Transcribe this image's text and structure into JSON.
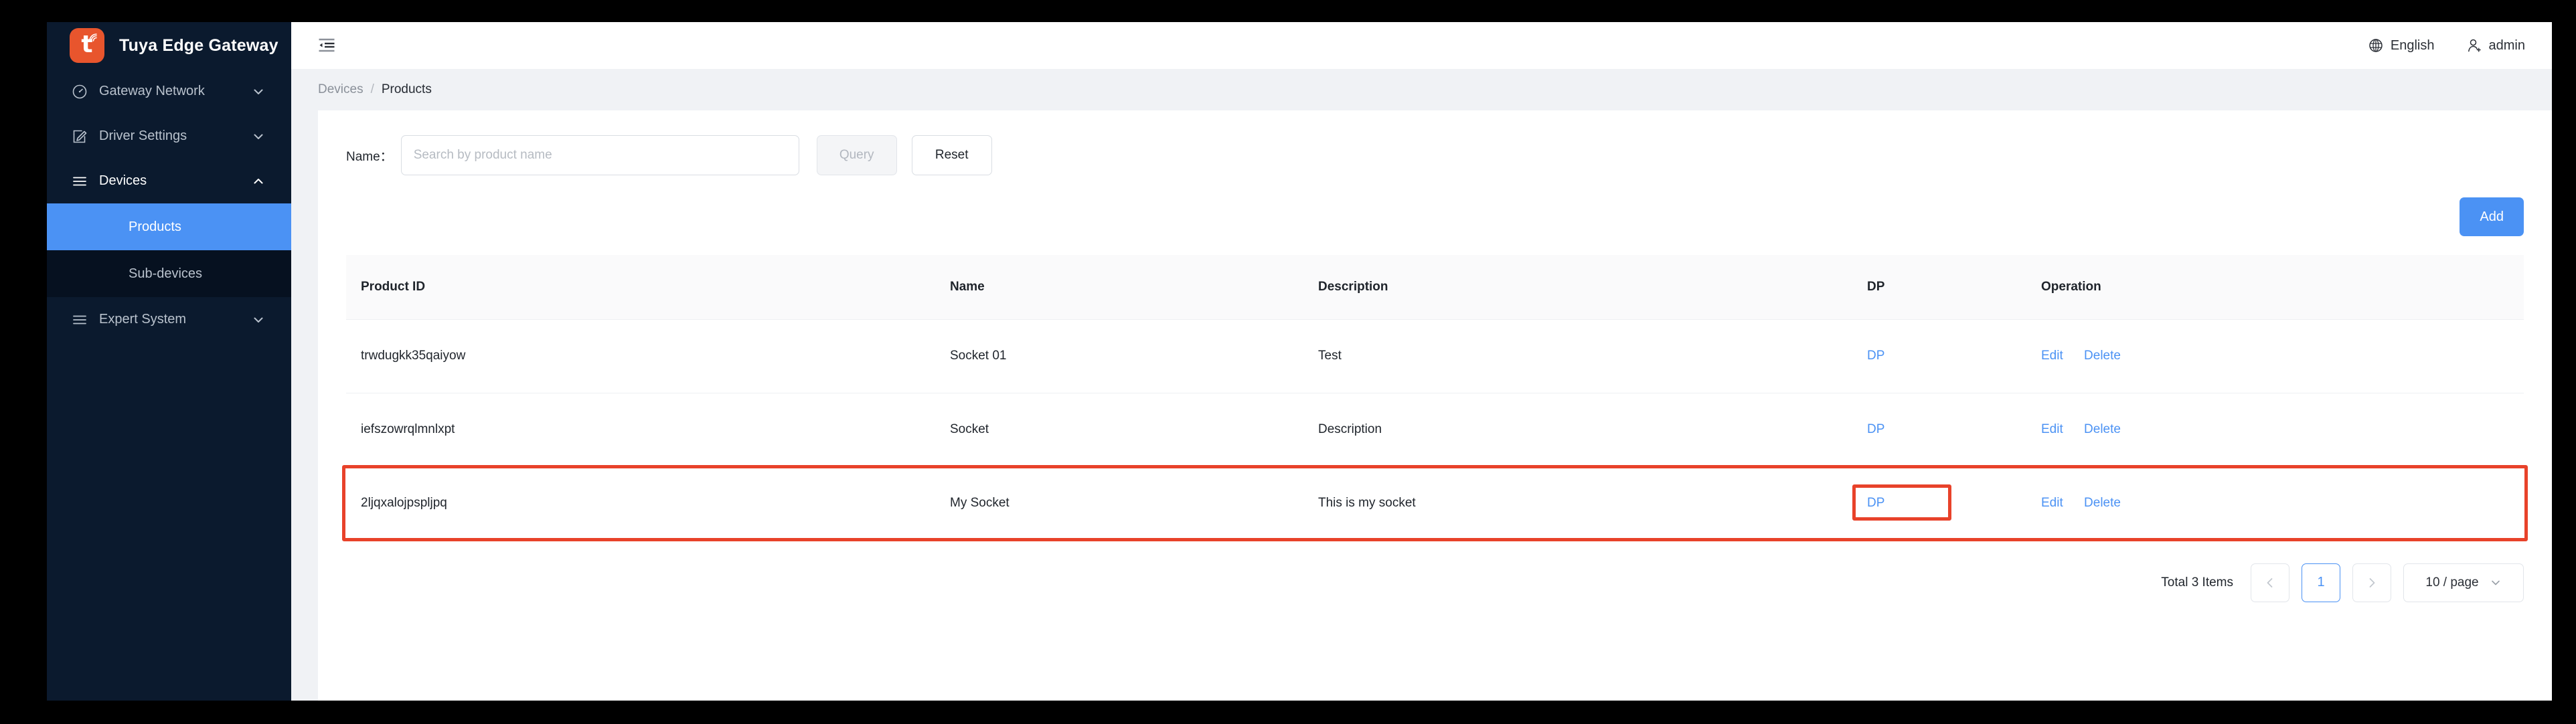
{
  "brand": {
    "title": "Tuya Edge Gateway",
    "logo_color": "#e8552d",
    "logo_glyph": "t"
  },
  "sidebar": {
    "background": "#0b1a2e",
    "active_color": "#4b92f4",
    "items": [
      {
        "label": "Gateway Network",
        "icon": "gauge-icon",
        "caret": "chevron-down-icon",
        "expanded": false
      },
      {
        "label": "Driver Settings",
        "icon": "edit-square-icon",
        "caret": "chevron-down-icon",
        "expanded": false
      },
      {
        "label": "Devices",
        "icon": "menu-lines-icon",
        "caret": "chevron-up-icon",
        "expanded": true
      },
      {
        "label": "Expert System",
        "icon": "menu-lines-icon",
        "caret": "chevron-down-icon",
        "expanded": false
      }
    ],
    "devices_children": [
      {
        "label": "Products",
        "active": true
      },
      {
        "label": "Sub-devices",
        "active": false
      }
    ]
  },
  "topbar": {
    "collapse_icon": "menu-fold-icon",
    "language": {
      "label": "English",
      "icon": "globe-icon"
    },
    "user": {
      "label": "admin",
      "icon": "user-add-icon"
    }
  },
  "breadcrumb": {
    "parent": "Devices",
    "separator": "/",
    "current": "Products"
  },
  "filter": {
    "name_label": "Name：",
    "search_placeholder": "Search by product name",
    "search_value": "",
    "query_label": "Query",
    "reset_label": "Reset"
  },
  "toolbar": {
    "add_label": "Add"
  },
  "table": {
    "columns": [
      "Product ID",
      "Name",
      "Description",
      "DP",
      "Operation"
    ],
    "rows": [
      {
        "product_id": "trwdugkk35qaiyow",
        "name": "Socket 01",
        "description": "Test",
        "dp": "DP",
        "edit": "Edit",
        "delete": "Delete",
        "highlighted": false
      },
      {
        "product_id": "iefszowrqlmnlxpt",
        "name": "Socket",
        "description": "Description",
        "dp": "DP",
        "edit": "Edit",
        "delete": "Delete",
        "highlighted": false
      },
      {
        "product_id": "2ljqxalojpspljpq",
        "name": "My Socket",
        "description": "This is my socket",
        "dp": "DP",
        "edit": "Edit",
        "delete": "Delete",
        "highlighted": true
      }
    ]
  },
  "pagination": {
    "total_text": "Total 3 Items",
    "prev_icon": "chevron-left-icon",
    "next_icon": "chevron-right-icon",
    "current_page": "1",
    "page_size": "10 / page",
    "page_size_caret": "chevron-down-icon"
  },
  "annotation": {
    "highlight_color": "#e8422a",
    "targets": [
      "product-row-3",
      "dp-link-row-3"
    ]
  }
}
